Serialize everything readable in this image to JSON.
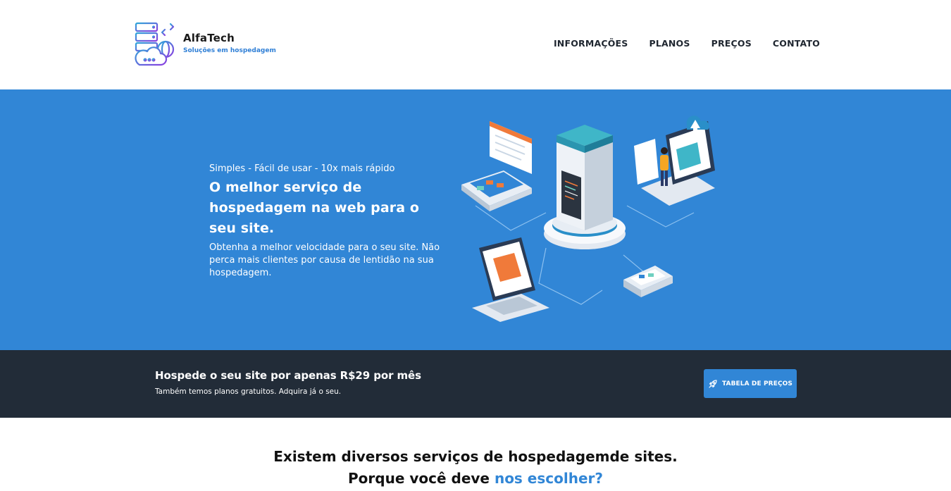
{
  "brand": {
    "name": "AlfaTech",
    "tagline": "Soluções em hospedagem"
  },
  "nav": {
    "items": [
      "INFORMAÇÕES",
      "PLANOS",
      "PREÇOS",
      "CONTATO"
    ]
  },
  "hero": {
    "tagline": "Simples - Fácil de usar - 10x mais rápido",
    "title": "O melhor serviço de hospedagem na web para o seu site.",
    "description": "Obtenha a melhor velocidade para o seu site. Não perca mais clientes por causa de lentidão na sua hospedagem.",
    "illustration": "server-hosting-isometric-illustration"
  },
  "promo": {
    "title": "Hospede o seu site por apenas R$29 por mês",
    "subtitle": "Também temos planos gratuitos. Adquira já o seu.",
    "button_label": "TABELA DE PREÇOS",
    "button_icon": "rocket-icon"
  },
  "why": {
    "line1": "Existem diversos serviços de hospedagemde sites.",
    "line2_prefix": "Porque você deve ",
    "line2_highlight": "nos escolher?"
  },
  "colors": {
    "accent": "#3186d6",
    "dark_band": "#222c38",
    "logo_gradient_start": "#2fa6d9",
    "logo_gradient_end": "#8a3ee0"
  }
}
